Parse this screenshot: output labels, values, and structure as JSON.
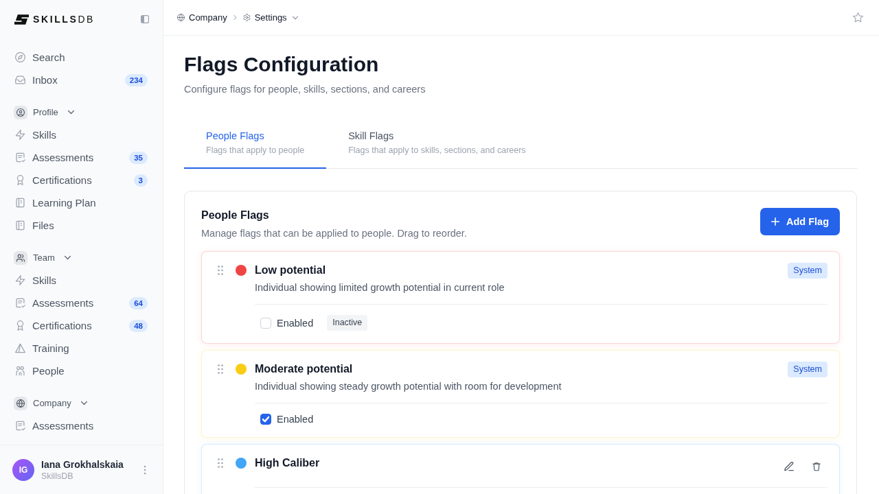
{
  "sidebar": {
    "logo": "**SKILLS**DB",
    "nav": [
      {
        "label": "Search",
        "kind": "search"
      },
      {
        "label": "Inbox",
        "kind": "inbox",
        "count": "234"
      }
    ],
    "sections": [
      {
        "label": "Profile",
        "kind": "user",
        "expanded": true,
        "items": [
          {
            "label": "Skills",
            "kind": "skills"
          },
          {
            "label": "Assessments",
            "kind": "assessments",
            "count": "35"
          },
          {
            "label": "Certifications",
            "kind": "certifications",
            "count": "3"
          },
          {
            "label": "Learning Plan",
            "kind": "plan"
          },
          {
            "label": "Files",
            "kind": "files"
          }
        ]
      },
      {
        "label": "Team",
        "kind": "team",
        "expanded": true,
        "items": [
          {
            "label": "Skills",
            "kind": "skills"
          },
          {
            "label": "Assessments",
            "kind": "assessments",
            "count": "64"
          },
          {
            "label": "Certifications",
            "kind": "certifications",
            "count": "48"
          },
          {
            "label": "Training",
            "kind": "training"
          },
          {
            "label": "People",
            "kind": "people"
          }
        ]
      },
      {
        "label": "Company",
        "kind": "company",
        "expanded": true,
        "items": [
          {
            "label": "Assessments",
            "kind": "assessments"
          }
        ]
      }
    ],
    "user": {
      "initials": "IG",
      "name": "Iana Grokhalskaia",
      "org": "SkillsDB"
    }
  },
  "breadcrumb": [
    {
      "label": "Company",
      "kind": "globe",
      "dropdown": false
    },
    {
      "label": "Settings",
      "kind": "settings",
      "dropdown": true
    }
  ],
  "page": {
    "title": "Flags Configuration",
    "subtitle": "Configure flags for people, skills, sections, and careers"
  },
  "tabs": [
    {
      "label": "People Flags",
      "description": "Flags that apply to people",
      "selected": true
    },
    {
      "label": "Skill Flags",
      "description": "Flags that apply to skills, sections, and careers",
      "selected": false
    }
  ],
  "panel": {
    "title": "People Flags",
    "description": "Manage flags that can be applied to people. Drag to reorder.",
    "button": "Add Flag"
  },
  "flags": [
    {
      "kind": "system",
      "name": "Low potential",
      "description": "Individual showing limited growth potential in current role",
      "color": "#ef4444",
      "badge": "System",
      "toggle_label": "Enabled",
      "checked": false,
      "status": "Inactive"
    },
    {
      "kind": "system",
      "name": "Moderate potential",
      "description": "Individual showing steady growth potential with room for development",
      "color": "#facc15",
      "badge": "System",
      "toggle_label": "Enabled",
      "checked": true
    },
    {
      "kind": "custom",
      "name": "High Caliber",
      "color": "#42a5f5"
    }
  ]
}
